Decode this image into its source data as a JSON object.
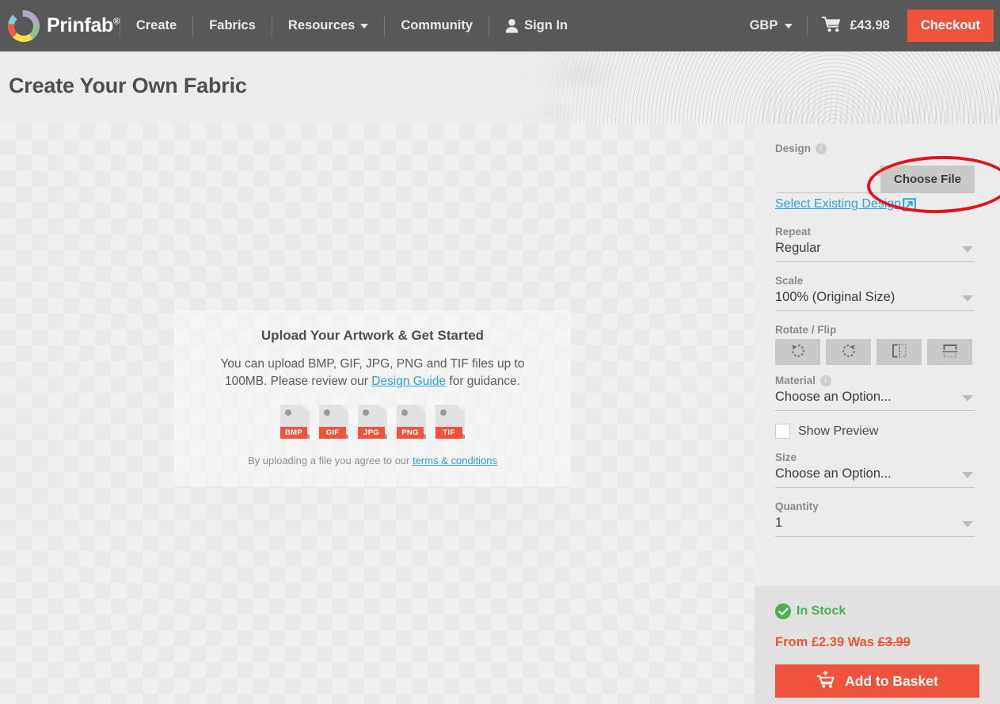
{
  "header": {
    "brand": "Prinfab",
    "brand_sup": "®",
    "logo_icon": "prinfab-ring-logo",
    "nav": [
      {
        "label": "Create",
        "icon": null,
        "has_caret": false
      },
      {
        "label": "Fabrics",
        "icon": null,
        "has_caret": false
      },
      {
        "label": "Resources",
        "icon": "chevron-down-icon",
        "has_caret": true
      },
      {
        "label": "Community",
        "icon": null,
        "has_caret": false
      },
      {
        "label": "Sign In",
        "icon": "person-icon",
        "has_caret": false
      }
    ],
    "currency": "GBP",
    "currency_icon": "chevron-down-icon",
    "cart_icon": "shopping-cart-icon",
    "cart_total": "£43.98",
    "checkout_label": "Checkout",
    "accent_color": "#f0533c",
    "bar_color": "#585858"
  },
  "hero": {
    "title": "Create Your Own Fabric",
    "image_alt": "rolled-fabric-measuring-tape-photo"
  },
  "canvas": {
    "upload": {
      "title": "Upload Your Artwork & Get Started",
      "description_pre": "You can upload BMP, GIF, JPG, PNG and TIF files up to 100MB. Please review our ",
      "description_link": "Design Guide",
      "description_post": " for guidance.",
      "file_types": [
        "BMP",
        "GIF",
        "JPG",
        "PNG",
        "TIF"
      ],
      "terms_pre": "By uploading a file you agree to our ",
      "terms_link": "terms & conditions"
    }
  },
  "sidebar": {
    "design": {
      "label": "Design",
      "info_icon": "info-icon",
      "choose_file_label": "Choose File",
      "highlight_color": "#e8111a",
      "select_existing_label": "Select Existing Design",
      "select_existing_icon": "external-link-icon"
    },
    "repeat": {
      "label": "Repeat",
      "value": "Regular",
      "icon": "chevron-down-icon"
    },
    "scale": {
      "label": "Scale",
      "value": "100% (Original Size)",
      "icon": "chevron-down-icon"
    },
    "rotate_flip": {
      "label": "Rotate / Flip",
      "buttons": [
        {
          "name": "rotate-left-icon",
          "title": "Rotate Left"
        },
        {
          "name": "rotate-right-icon",
          "title": "Rotate Right"
        },
        {
          "name": "flip-horizontal-icon",
          "title": "Flip Horizontal"
        },
        {
          "name": "flip-vertical-icon",
          "title": "Flip Vertical"
        }
      ]
    },
    "material": {
      "label": "Material",
      "info_icon": "info-icon",
      "value": "Choose an Option...",
      "icon": "chevron-down-icon"
    },
    "show_preview": {
      "label": "Show Preview",
      "checked": false
    },
    "size": {
      "label": "Size",
      "value": "Choose an Option...",
      "icon": "chevron-down-icon"
    },
    "quantity": {
      "label": "Quantity",
      "value": "1",
      "icon": "chevron-down-icon"
    },
    "purchase": {
      "stock_icon": "check-circle-icon",
      "stock_label": "In Stock",
      "stock_color": "#4caf50",
      "price_from": "From £2.39 Was ",
      "price_was": "£3.99",
      "price_color": "#f0533c",
      "basket_icon": "add-to-cart-icon",
      "basket_label": "Add to Basket"
    }
  }
}
